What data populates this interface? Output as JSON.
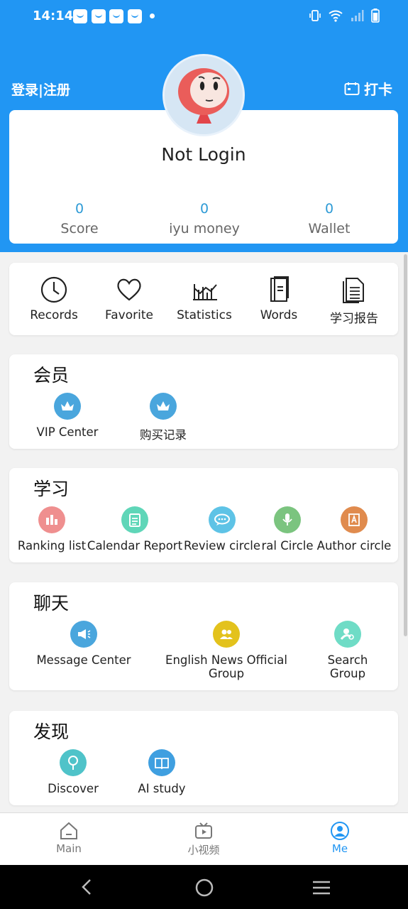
{
  "status_bar": {
    "time": "14:14"
  },
  "header": {
    "login_link": "登录|注册",
    "checkin_label": "打卡"
  },
  "profile": {
    "name": "Not Login",
    "stats": [
      {
        "value": "0",
        "label": "Score"
      },
      {
        "value": "0",
        "label": "iyu money"
      },
      {
        "value": "0",
        "label": "Wallet"
      }
    ]
  },
  "tools": [
    {
      "label": "Records",
      "icon": "clock-icon"
    },
    {
      "label": "Favorite",
      "icon": "heart-icon"
    },
    {
      "label": "Statistics",
      "icon": "statistics-icon"
    },
    {
      "label": "Words",
      "icon": "book-icon"
    },
    {
      "label": "学习报告",
      "icon": "report-icon"
    }
  ],
  "sections": {
    "member": {
      "title": "会员",
      "items": [
        {
          "label": "VIP Center",
          "icon": "crown-icon",
          "color": "#4aa6dd"
        },
        {
          "label": "购买记录",
          "icon": "crown-icon",
          "color": "#4aa6dd"
        }
      ]
    },
    "study": {
      "title": "学习",
      "items": [
        {
          "label": "Ranking list",
          "icon": "ranking-icon",
          "color": "#ef8f8f"
        },
        {
          "label": "Calendar Report",
          "icon": "calendar-report-icon",
          "color": "#5fd6b8"
        },
        {
          "label": "Review circle",
          "icon": "chat-bubble-icon",
          "color": "#5ec3e6"
        },
        {
          "label": "ral Circle",
          "icon": "microphone-icon",
          "color": "#7bc47f"
        },
        {
          "label": "Author circle",
          "icon": "author-icon",
          "color": "#e08b4e"
        }
      ]
    },
    "chat": {
      "title": "聊天",
      "items": [
        {
          "label": "Message Center",
          "icon": "megaphone-icon",
          "color": "#4aa6dd"
        },
        {
          "label": "English News Official Group",
          "icon": "group-icon",
          "color": "#e3c21c"
        },
        {
          "label": "Search Group",
          "icon": "search-group-icon",
          "color": "#6fdcc6"
        }
      ]
    },
    "discover": {
      "title": "发现",
      "items": [
        {
          "label": "Discover",
          "icon": "discover-icon",
          "color": "#4fc3c9"
        },
        {
          "label": "AI study",
          "icon": "ai-study-icon",
          "color": "#3f9fe0"
        }
      ]
    }
  },
  "bottom_nav": [
    {
      "label": "Main",
      "icon": "home-icon"
    },
    {
      "label": "小视频",
      "icon": "video-icon"
    },
    {
      "label": "Me",
      "icon": "me-icon",
      "active": true
    }
  ],
  "colors": {
    "header_blue": "#2196f3",
    "accent": "#2e9bd6"
  }
}
